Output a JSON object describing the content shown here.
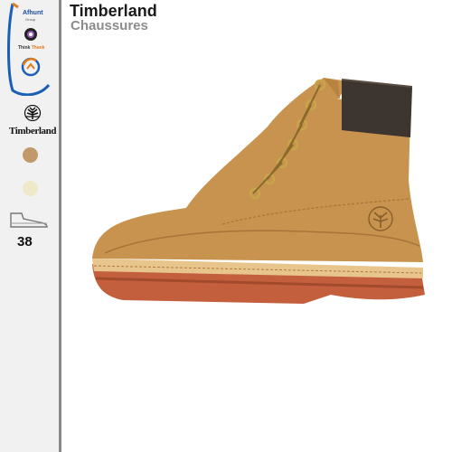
{
  "header": {
    "title": "Timberland",
    "subtitle": "Chaussures"
  },
  "sidebar": {
    "logos": {
      "afhunt": "Afhunt",
      "afhunt_sub": "Group",
      "think_a": "Think",
      "think_b": "Thank"
    },
    "brand_logo": {
      "icon": "tree-icon",
      "text": "Timberland"
    },
    "colors": [
      {
        "name": "wheat",
        "hex": "#c19a6b"
      },
      {
        "name": "cream",
        "hex": "#efe9c9"
      }
    ],
    "size_icon": "shoe-icon",
    "size": "38"
  },
  "product": {
    "icon": "boot-image"
  }
}
